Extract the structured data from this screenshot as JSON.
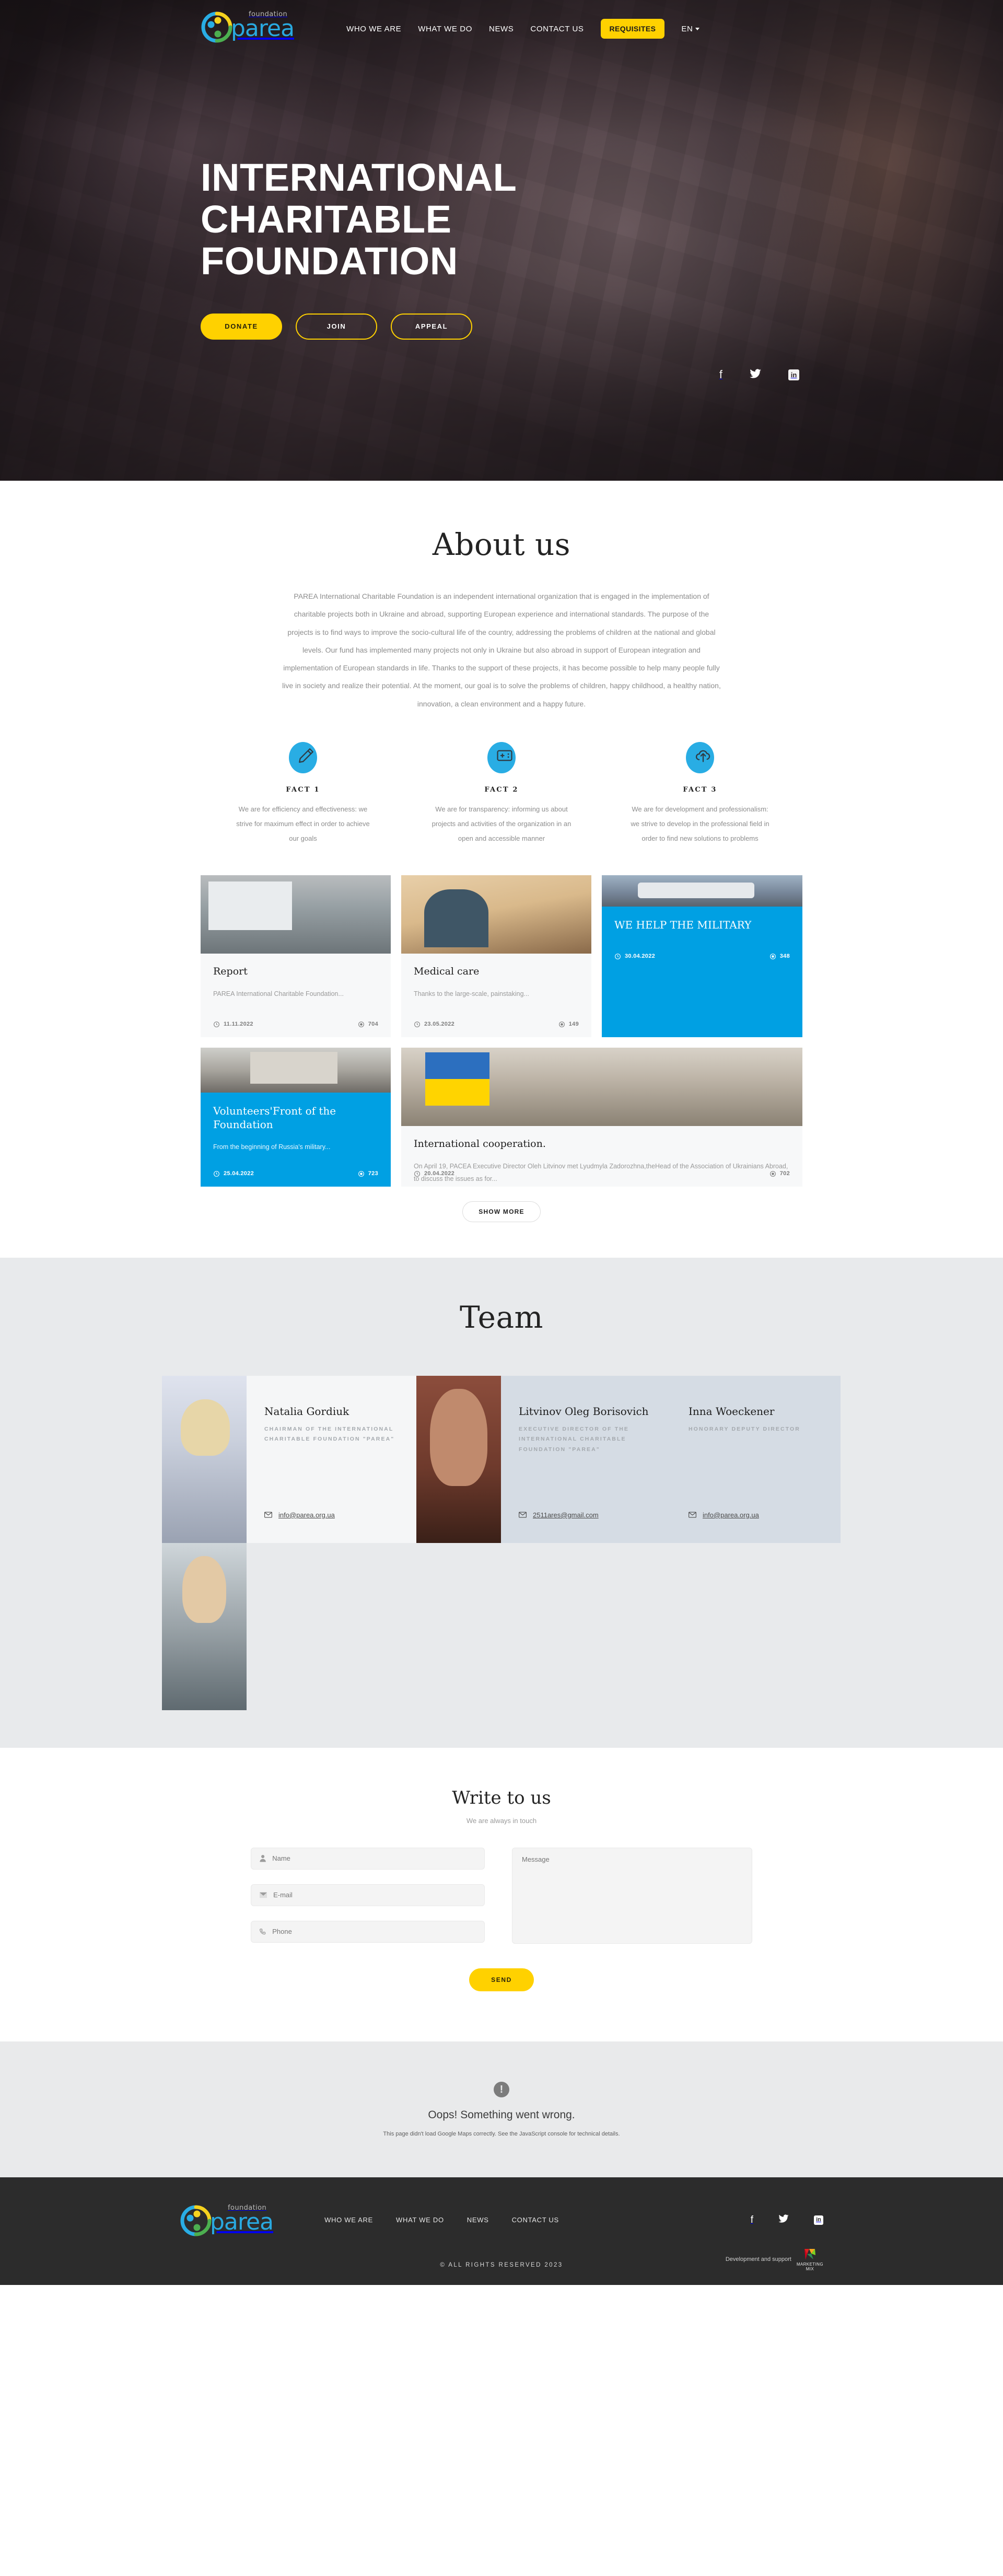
{
  "brand": {
    "name": "parea",
    "tagline": "foundation",
    "accent_yellow": "#ffd100",
    "accent_blue": "#00a0e3"
  },
  "header": {
    "nav": [
      {
        "label": "WHO WE ARE"
      },
      {
        "label": "WHAT WE DO"
      },
      {
        "label": "NEWS"
      },
      {
        "label": "CONTACT US"
      }
    ],
    "requisites_label": "REQUISITES",
    "language": "EN"
  },
  "hero": {
    "title_lines": [
      "INTERNATIONAL",
      "CHARITABLE",
      "FOUNDATION"
    ],
    "buttons": [
      {
        "label": "DONATE",
        "style": "solid"
      },
      {
        "label": "JOIN",
        "style": "ghost"
      },
      {
        "label": "APPEAL",
        "style": "ghost"
      }
    ],
    "social": [
      {
        "name": "facebook-icon",
        "glyph": "f"
      },
      {
        "name": "twitter-icon",
        "glyph": "🐦"
      },
      {
        "name": "linkedin-icon",
        "glyph": "in"
      }
    ]
  },
  "about": {
    "title": "About us",
    "body": "PAREA International Charitable Foundation is an independent international organization that is engaged in the implementation of charitable projects both in Ukraine and abroad, supporting European experience and international standards. The purpose of the projects is to find ways to improve the socio-cultural life of the country, addressing the problems of children at the national and global levels. Our fund has implemented many projects not only in Ukraine but also abroad in support of European integration and implementation of European standards in life. Thanks to the support of these projects, it has become possible to help many people fully live in society and realize their potential. At the moment, our goal is to solve the problems of children, happy childhood, a healthy nation, innovation, a clean environment and a happy future.",
    "facts": [
      {
        "icon": "pencil-icon",
        "title": "FACT 1",
        "text": "We are for efficiency and effectiveness: we strive for maximum effect in order to achieve our goals"
      },
      {
        "icon": "card-add-icon",
        "title": "FACT 2",
        "text": "We are for transparency: informing us about projects and activities of the organization in an open and accessible manner"
      },
      {
        "icon": "cloud-upload-icon",
        "title": "FACT 3",
        "text": "We are for development and professionalism: we strive to develop in the professional field in order to find new solutions to problems"
      }
    ]
  },
  "news": {
    "cards": [
      {
        "title": "Report",
        "excerpt": "PAREA International Charitable Foundation...",
        "date": "11.11.2022",
        "views": "704",
        "highlight": false
      },
      {
        "title": "Medical care",
        "excerpt": "Thanks to the large-scale, painstaking...",
        "date": "23.05.2022",
        "views": "149",
        "highlight": false
      },
      {
        "title": "WE HELP THE MILITARY",
        "excerpt": "",
        "date": "30.04.2022",
        "views": "348",
        "highlight": true
      },
      {
        "title": "Volunteers'Front of the Foundation",
        "excerpt": "From the beginning of Russia's military...",
        "date": "25.04.2022",
        "views": "723",
        "highlight": true
      },
      {
        "title": "International cooperation.",
        "excerpt": "On April 19, PACEA Executive Director Oleh Litvinov met Lyudmyla Zadorozhna,theHead of the Association of Ukrainians Abroad, to discuss the issues as for...",
        "date": "20.04.2022",
        "views": "702",
        "highlight": false
      }
    ],
    "show_more_label": "SHOW MORE"
  },
  "team": {
    "title": "Team",
    "members": [
      {
        "name": "Natalia Gordiuk",
        "role": "CHAIRMAN OF THE INTERNATIONAL CHARITABLE FOUNDATION \"PAREA\"",
        "email": "info@parea.org.ua"
      },
      {
        "name": "Litvinov Oleg Borisovich",
        "role": "EXECUTIVE DIRECTOR OF THE INTERNATIONAL CHARITABLE FOUNDATION \"PAREA\"",
        "email": "2511ares@gmail.com"
      },
      {
        "name": "Inna Woeckener",
        "role": "HONORARY DEPUTY DIRECTOR",
        "email": "info@parea.org.ua"
      }
    ]
  },
  "contact": {
    "title": "Write to us",
    "subtitle": "We are always in touch",
    "fields": [
      {
        "icon": "user-icon",
        "placeholder": "Name",
        "value": ""
      },
      {
        "icon": "envelope-icon",
        "placeholder": "E-mail",
        "value": ""
      },
      {
        "icon": "phone-icon",
        "placeholder": "Phone",
        "value": ""
      }
    ],
    "message_placeholder": "Message",
    "message_value": "",
    "send_label": "SEND"
  },
  "map_error": {
    "icon": "exclamation-icon",
    "glyph": "!",
    "headline": "Oops! Something went wrong.",
    "detail": "This page didn't load Google Maps correctly. See the JavaScript console for technical details."
  },
  "footer": {
    "nav": [
      {
        "label": "WHO WE ARE"
      },
      {
        "label": "WHAT WE DO"
      },
      {
        "label": "NEWS"
      },
      {
        "label": "CONTACT US"
      }
    ],
    "social": [
      {
        "name": "facebook-icon",
        "glyph": "f"
      },
      {
        "name": "twitter-icon",
        "glyph": "🐦"
      },
      {
        "name": "linkedin-icon",
        "glyph": "in"
      }
    ],
    "copyright": "© ALL RIGHTS RESERVED 2023",
    "dev_label": "Development and support",
    "dev_brand_line1": "MARKETING",
    "dev_brand_line2": "MIX"
  }
}
